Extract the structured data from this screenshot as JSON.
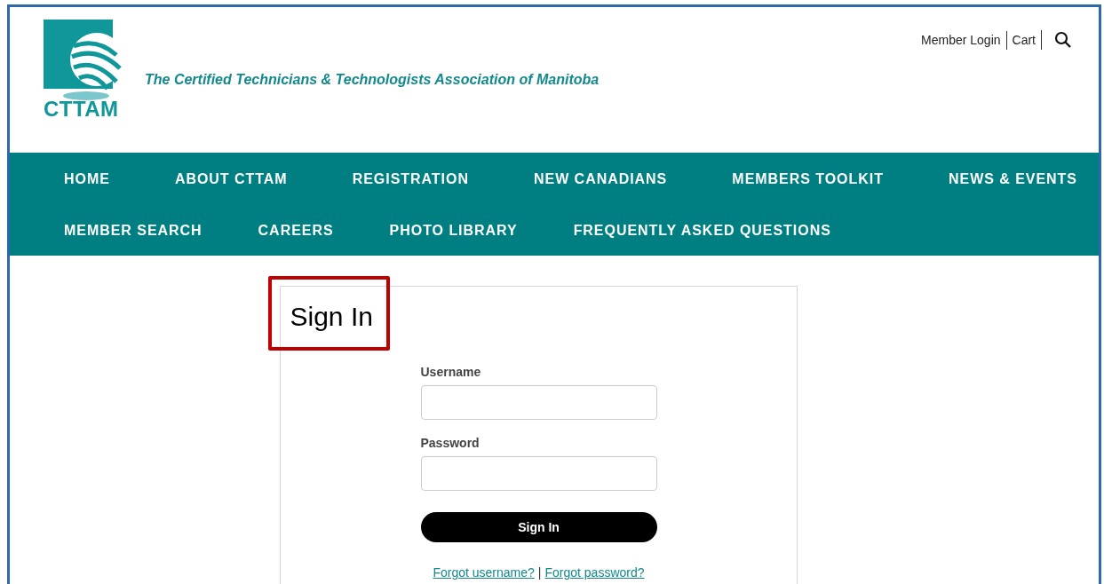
{
  "header": {
    "logo_text": "CTTAM",
    "tagline": "The Certified Technicians & Technologists Association of Manitoba",
    "utility_links": [
      "Member Login",
      "Cart"
    ]
  },
  "nav": {
    "rows": [
      [
        "HOME",
        "ABOUT CTTAM",
        "REGISTRATION",
        "NEW CANADIANS",
        "MEMBERS TOOLKIT",
        "NEWS & EVENTS"
      ],
      [
        "MEMBER SEARCH",
        "CAREERS",
        "PHOTO LIBRARY",
        "FREQUENTLY ASKED QUESTIONS"
      ]
    ]
  },
  "sign_in": {
    "title": "Sign In",
    "title_highlighted": true,
    "fields": [
      {
        "label": "Username"
      },
      {
        "label": "Password"
      }
    ],
    "button": "Sign In",
    "links": [
      "Forgot username?",
      "Forgot password?"
    ],
    "link_separator": "|"
  }
}
